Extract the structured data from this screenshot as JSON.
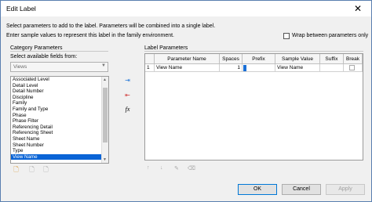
{
  "window": {
    "title": "Edit Label",
    "close_icon": "close-icon"
  },
  "instructions": {
    "line1": "Select parameters to add to the label.  Parameters will be combined into a single label.",
    "line2": "Enter sample values to represent this label in the family environment.",
    "wrap_label": "Wrap between parameters only",
    "wrap_checked": false
  },
  "category_parameters": {
    "title": "Category Parameters",
    "select_label": "Select available fields from:",
    "select_value": "Views",
    "fields": [
      "Associated Level",
      "Detail Level",
      "Detail Number",
      "Discipline",
      "Family",
      "Family and Type",
      "Phase",
      "Phase Filter",
      "Referencing Detail",
      "Referencing Sheet",
      "Sheet Name",
      "Sheet Number",
      "Type",
      "View Name"
    ],
    "selected_field": "View Name"
  },
  "label_parameters": {
    "title": "Label Parameters",
    "columns": [
      "Parameter Name",
      "Spaces",
      "Prefix",
      "Sample Value",
      "Suffix",
      "Break"
    ],
    "rows": [
      {
        "index": "1",
        "parameter_name": "View Name",
        "spaces": "1",
        "prefix": "",
        "sample_value": "View Name",
        "suffix": "",
        "break": false
      }
    ]
  },
  "buttons": {
    "ok": "OK",
    "cancel": "Cancel",
    "apply": "Apply"
  },
  "icons": {
    "add": "add-parameter-icon",
    "remove": "remove-parameter-icon",
    "fx": "fx",
    "move_up": "↑",
    "move_down": "↓"
  }
}
